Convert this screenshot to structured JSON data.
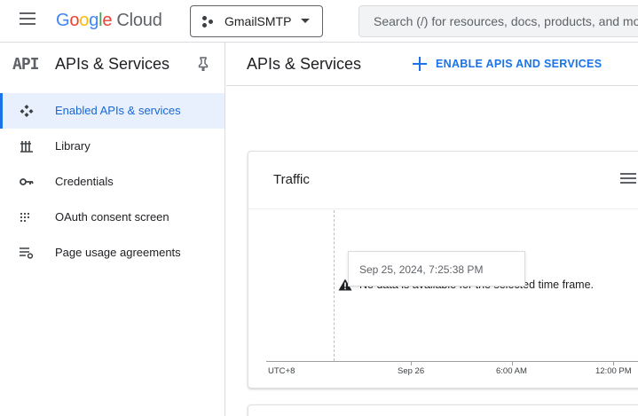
{
  "topbar": {
    "logo": {
      "letters": [
        "G",
        "o",
        "o",
        "g",
        "l",
        "e"
      ],
      "product": "Cloud"
    },
    "project": "GmailSMTP",
    "search_placeholder": "Search (/) for resources, docs, products, and more"
  },
  "sidebar": {
    "mark": "API",
    "title": "APIs & Services",
    "items": [
      {
        "label": "Enabled APIs & services",
        "icon": "enabled-apis-icon",
        "active": true
      },
      {
        "label": "Library",
        "icon": "library-icon",
        "active": false
      },
      {
        "label": "Credentials",
        "icon": "key-icon",
        "active": false
      },
      {
        "label": "OAuth consent screen",
        "icon": "oauth-consent-icon",
        "active": false
      },
      {
        "label": "Page usage agreements",
        "icon": "page-usage-icon",
        "active": false
      }
    ]
  },
  "main": {
    "title": "APIs & Services",
    "enable_button": "ENABLE APIS AND SERVICES"
  },
  "traffic_card": {
    "title": "Traffic",
    "tooltip": "Sep 25, 2024, 7:25:38 PM",
    "empty_message": "No data is available for the selected time frame.",
    "axis_labels": [
      "UTC+8",
      "Sep 26",
      "6:00 AM",
      "12:00 PM"
    ]
  },
  "colors": {
    "accent": "#1a73e8",
    "active_bg": "#e8f0fe"
  }
}
